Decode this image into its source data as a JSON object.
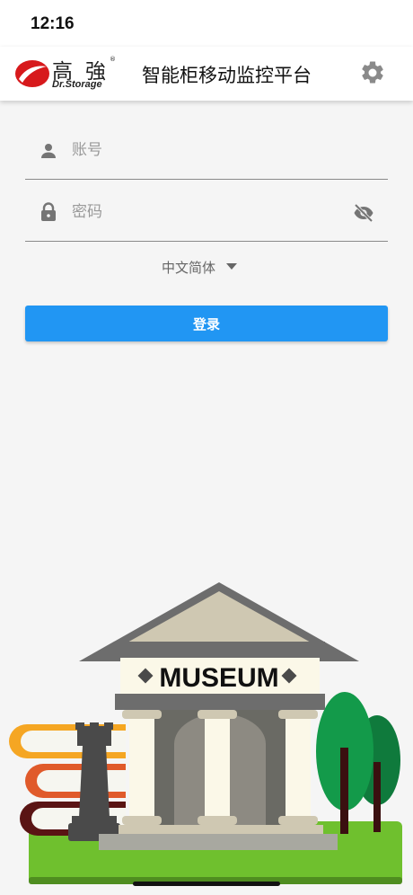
{
  "status_bar": {
    "time": "12:16"
  },
  "header": {
    "logo_cn": "高強",
    "logo_en": "Dr.Storage",
    "logo_reg": "®",
    "title": "智能柜移动监控平台",
    "settings_icon": "gear-icon"
  },
  "form": {
    "account": {
      "placeholder": "账号",
      "value": "",
      "icon": "user-icon"
    },
    "password": {
      "placeholder": "密码",
      "value": "",
      "icon": "lock-icon",
      "toggle_icon": "eye-off-icon"
    },
    "language": {
      "selected": "中文简体",
      "icon": "caret-down-icon"
    },
    "login_label": "登录"
  },
  "illustration": {
    "sign": "MUSEUM"
  },
  "colors": {
    "primary": "#2196f3",
    "icon_gray": "#757575",
    "brand_red": "#d7191c",
    "grass": "#6fc02e"
  }
}
